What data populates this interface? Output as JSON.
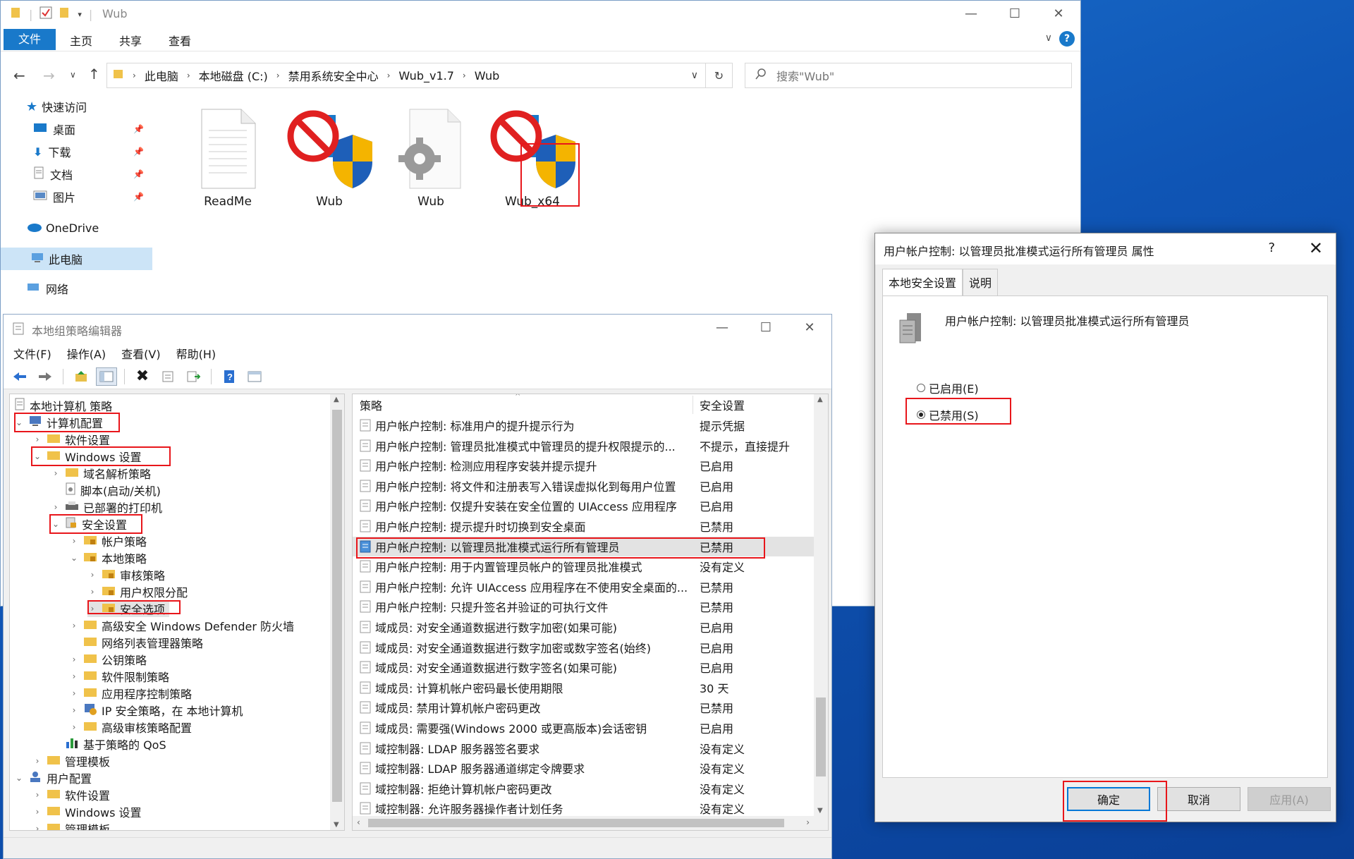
{
  "explorer": {
    "title": "Wub",
    "ribbon": {
      "file": "文件",
      "home": "主页",
      "share": "共享",
      "view": "查看"
    },
    "breadcrumb": [
      "此电脑",
      "本地磁盘 (C:)",
      "禁用系统安全中心",
      "Wub_v1.7",
      "Wub"
    ],
    "search_placeholder": "搜索\"Wub\"",
    "nav": {
      "quick_access": "快速访问",
      "desktop": "桌面",
      "downloads": "下载",
      "documents": "文档",
      "pictures": "图片",
      "onedrive": "OneDrive",
      "this_pc": "此电脑",
      "network": "网络"
    },
    "files": [
      "ReadMe",
      "Wub",
      "Wub",
      "Wub_x64"
    ]
  },
  "gpedit": {
    "title": "本地组策略编辑器",
    "menu": [
      "文件(F)",
      "操作(A)",
      "查看(V)",
      "帮助(H)"
    ],
    "tree": [
      "本地计算机 策略",
      "计算机配置",
      "软件设置",
      "Windows 设置",
      "域名解析策略",
      "脚本(启动/关机)",
      "已部署的打印机",
      "安全设置",
      "帐户策略",
      "本地策略",
      "审核策略",
      "用户权限分配",
      "安全选项",
      "高级安全 Windows Defender 防火墙",
      "网络列表管理器策略",
      "公钥策略",
      "软件限制策略",
      "应用程序控制策略",
      "IP 安全策略，在 本地计算机",
      "高级审核策略配置",
      "基于策略的 QoS",
      "管理模板",
      "用户配置",
      "软件设置",
      "Windows 设置",
      "管理模板"
    ],
    "columns": {
      "policy": "策略",
      "setting": "安全设置"
    },
    "rows": [
      {
        "policy": "用户帐户控制: 标准用户的提升提示行为",
        "setting": "提示凭据"
      },
      {
        "policy": "用户帐户控制: 管理员批准模式中管理员的提升权限提示的...",
        "setting": "不提示，直接提升"
      },
      {
        "policy": "用户帐户控制: 检测应用程序安装并提示提升",
        "setting": "已启用"
      },
      {
        "policy": "用户帐户控制: 将文件和注册表写入错误虚拟化到每用户位置",
        "setting": "已启用"
      },
      {
        "policy": "用户帐户控制: 仅提升安装在安全位置的 UIAccess 应用程序",
        "setting": "已启用"
      },
      {
        "policy": "用户帐户控制: 提示提升时切换到安全桌面",
        "setting": "已禁用"
      },
      {
        "policy": "用户帐户控制: 以管理员批准模式运行所有管理员",
        "setting": "已禁用"
      },
      {
        "policy": "用户帐户控制: 用于内置管理员帐户的管理员批准模式",
        "setting": "没有定义"
      },
      {
        "policy": "用户帐户控制: 允许 UIAccess 应用程序在不使用安全桌面的...",
        "setting": "已禁用"
      },
      {
        "policy": "用户帐户控制: 只提升签名并验证的可执行文件",
        "setting": "已禁用"
      },
      {
        "policy": "域成员: 对安全通道数据进行数字加密(如果可能)",
        "setting": "已启用"
      },
      {
        "policy": "域成员: 对安全通道数据进行数字加密或数字签名(始终)",
        "setting": "已启用"
      },
      {
        "policy": "域成员: 对安全通道数据进行数字签名(如果可能)",
        "setting": "已启用"
      },
      {
        "policy": "域成员: 计算机帐户密码最长使用期限",
        "setting": "30 天"
      },
      {
        "policy": "域成员: 禁用计算机帐户密码更改",
        "setting": "已禁用"
      },
      {
        "policy": "域成员: 需要强(Windows 2000 或更高版本)会话密钥",
        "setting": "已启用"
      },
      {
        "policy": "域控制器: LDAP 服务器签名要求",
        "setting": "没有定义"
      },
      {
        "policy": "域控制器: LDAP 服务器通道绑定令牌要求",
        "setting": "没有定义"
      },
      {
        "policy": "域控制器: 拒绝计算机帐户密码更改",
        "setting": "没有定义"
      },
      {
        "policy": "域控制器: 允许服务器操作者计划任务",
        "setting": "没有定义"
      }
    ]
  },
  "props": {
    "title": "用户帐户控制: 以管理员批准模式运行所有管理员 属性",
    "help": "?",
    "close": "✕",
    "tabs": [
      "本地安全设置",
      "说明"
    ],
    "policy_name": "用户帐户控制: 以管理员批准模式运行所有管理员",
    "enabled_label": "已启用(E)",
    "disabled_label": "已禁用(S)",
    "selected": "disabled",
    "ok": "确定",
    "cancel": "取消",
    "apply": "应用(A)"
  },
  "colors": {
    "accent": "#1979ca",
    "highlight": "#e8161b"
  }
}
